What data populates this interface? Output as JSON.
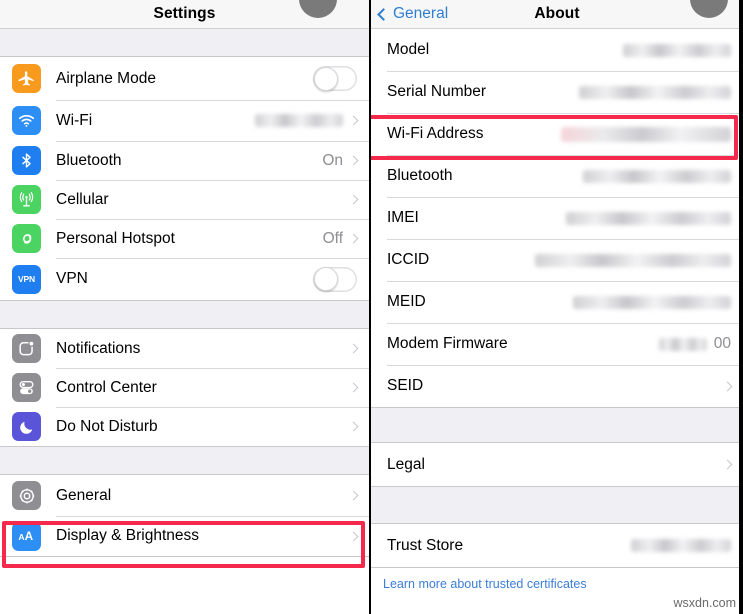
{
  "left_panel": {
    "navbar": {
      "title": "Settings"
    },
    "groups": [
      {
        "rows": [
          {
            "label": "Airplane Mode",
            "icon": "airplane-icon",
            "icon_color": "#f79a1e",
            "accessory": "toggle",
            "value": ""
          },
          {
            "label": "Wi-Fi",
            "icon": "wifi-icon",
            "icon_color": "#2d8ef5",
            "accessory": "blur-chevron",
            "value": ""
          },
          {
            "label": "Bluetooth",
            "icon": "bluetooth-icon",
            "icon_color": "#1f7ef0",
            "accessory": "value-chevron",
            "value": "On"
          },
          {
            "label": "Cellular",
            "icon": "cellular-antenna-icon",
            "icon_color": "#4cd462",
            "accessory": "chevron",
            "value": ""
          },
          {
            "label": "Personal Hotspot",
            "icon": "hotspot-link-icon",
            "icon_color": "#4cd462",
            "accessory": "value-chevron",
            "value": "Off"
          },
          {
            "label": "VPN",
            "icon": "vpn-icon",
            "icon_color": "#1f7ef0",
            "accessory": "toggle",
            "value": ""
          }
        ]
      },
      {
        "rows": [
          {
            "label": "Notifications",
            "icon": "notifications-badge-icon",
            "icon_color": "#8e8e93",
            "accessory": "chevron",
            "value": ""
          },
          {
            "label": "Control Center",
            "icon": "control-center-sliders-icon",
            "icon_color": "#8e8e93",
            "accessory": "chevron",
            "value": ""
          },
          {
            "label": "Do Not Disturb",
            "icon": "moon-icon",
            "icon_color": "#5a55d8",
            "accessory": "chevron",
            "value": ""
          }
        ]
      },
      {
        "rows": [
          {
            "label": "General",
            "icon": "gear-icon",
            "icon_color": "#8e8e93",
            "accessory": "chevron",
            "value": "",
            "highlighted": true
          },
          {
            "label": "Display & Brightness",
            "icon": "text-size-aa-icon",
            "icon_color": "#2d8ef5",
            "accessory": "chevron",
            "value": ""
          }
        ]
      }
    ]
  },
  "right_panel": {
    "navbar": {
      "back_label": "General",
      "title": "About"
    },
    "groups": [
      {
        "rows": [
          {
            "label": "Model",
            "accessory": "blur",
            "value": "",
            "blur_width": 108,
            "blur_style": "plain"
          },
          {
            "label": "Serial Number",
            "accessory": "blur",
            "value": "",
            "blur_width": 152,
            "blur_style": "plain"
          },
          {
            "label": "Wi-Fi Address",
            "accessory": "blur",
            "value": "",
            "blur_width": 170,
            "blur_style": "pinkish",
            "highlighted": true
          },
          {
            "label": "Bluetooth",
            "accessory": "blur",
            "value": "",
            "blur_width": 148,
            "blur_style": "plain"
          },
          {
            "label": "IMEI",
            "accessory": "blur",
            "value": "",
            "blur_width": 165,
            "blur_style": "plain"
          },
          {
            "label": "ICCID",
            "accessory": "blur",
            "value": "",
            "blur_width": 196,
            "blur_style": "plain"
          },
          {
            "label": "MEID",
            "accessory": "blur",
            "value": "",
            "blur_width": 158,
            "blur_style": "plain"
          },
          {
            "label": "Modem Firmware",
            "accessory": "blur-value",
            "value": "00",
            "blur_width": 48,
            "blur_style": "plain"
          },
          {
            "label": "SEID",
            "accessory": "chevron",
            "value": ""
          }
        ]
      },
      {
        "rows": [
          {
            "label": "Legal",
            "accessory": "chevron",
            "value": ""
          }
        ]
      },
      {
        "rows": [
          {
            "label": "Trust Store",
            "accessory": "blur",
            "value": "",
            "blur_width": 100,
            "blur_style": "plain"
          }
        ],
        "footnote": "Learn more about trusted certificates"
      }
    ]
  },
  "annotations": {
    "highlight_color": "#f5294b",
    "cursor_color": "#7a7a7a"
  },
  "watermark": {
    "text": "wsxdn.com"
  }
}
